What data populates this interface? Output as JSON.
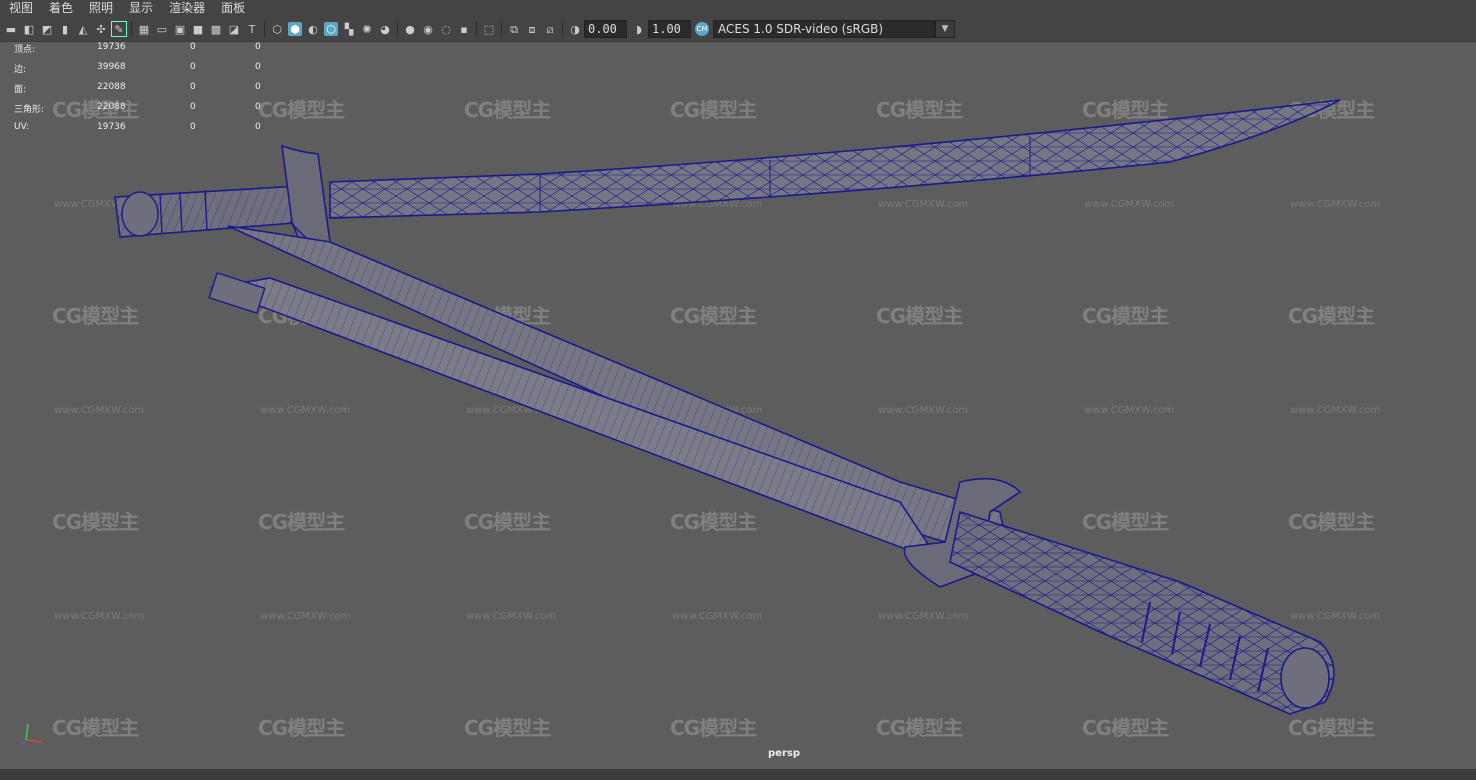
{
  "menu": [
    "视图",
    "着色",
    "照明",
    "显示",
    "渲染器",
    "面板"
  ],
  "toolbar": {
    "exposure": "0.00",
    "gamma": "1.00",
    "color_space": "ACES 1.0 SDR-video (sRGB)"
  },
  "hud": [
    {
      "label": "顶点:",
      "v1": "19736",
      "v2": "0",
      "v3": "0"
    },
    {
      "label": "边:",
      "v1": "39968",
      "v2": "0",
      "v3": "0"
    },
    {
      "label": "面:",
      "v1": "22088",
      "v2": "0",
      "v3": "0"
    },
    {
      "label": "三角形:",
      "v1": "22088",
      "v2": "0",
      "v3": "0"
    },
    {
      "label": "UV:",
      "v1": "19736",
      "v2": "0",
      "v3": "0"
    }
  ],
  "watermark": {
    "logo": "CG模型主",
    "url": "www.CGMXW.com"
  },
  "camera": "persp",
  "colors": {
    "wire": "#1a1a8c",
    "mesh": "#7a7a86",
    "bg": "#5d5d5d"
  }
}
